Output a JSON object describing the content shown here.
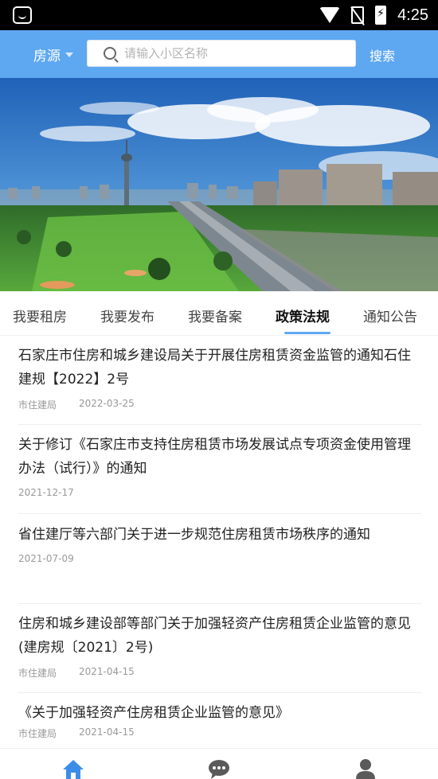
{
  "status_bar": {
    "time": "4:25"
  },
  "header": {
    "city_label": "房源",
    "search_placeholder": "请输入小区名称",
    "search_button": "搜索"
  },
  "tabs": [
    {
      "label": "我要租房"
    },
    {
      "label": "我要发布"
    },
    {
      "label": "我要备案"
    },
    {
      "label": "政策法规"
    },
    {
      "label": "通知公告"
    }
  ],
  "active_tab": "政策法规",
  "news": [
    {
      "title": "石家庄市住房和城乡建设局关于开展住房租赁资金监管的通知石住建规【2022】2号",
      "source": "市住建局",
      "date": "2022-03-25"
    },
    {
      "title": "关于修订《石家庄市支持住房租赁市场发展试点专项资金使用管理办法（试行）》的通知",
      "source": "",
      "date": "2021-12-17"
    },
    {
      "title": "省住建厅等六部门关于进一步规范住房租赁市场秩序的通知",
      "source": "",
      "date": "2021-07-09"
    },
    {
      "title": "住房和城乡建设部等部门关于加强轻资产住房租赁企业监管的意见(建房规〔2021〕2号)",
      "source": "市住建局",
      "date": "2021-04-15"
    },
    {
      "title": "《关于加强轻资产住房租赁企业监管的意见》",
      "source": "市住建局",
      "date": "2021-04-15"
    }
  ],
  "bottom_nav": [
    {
      "icon": "home-icon"
    },
    {
      "icon": "chat-icon"
    },
    {
      "icon": "user-icon"
    }
  ],
  "colors": {
    "accent": "#5ea8f2"
  }
}
